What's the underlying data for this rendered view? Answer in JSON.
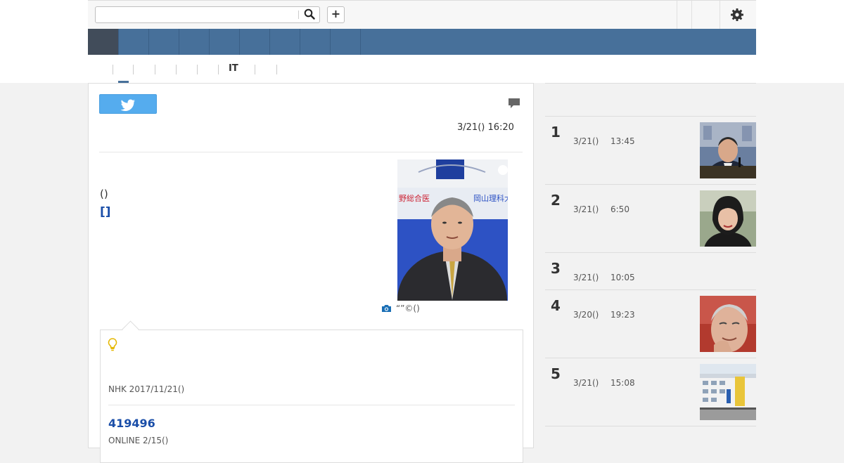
{
  "toolbar": {
    "search_placeholder": "",
    "search_icon": "search-icon",
    "add_label": "+",
    "settings_icon": "gear-icon"
  },
  "categories": {
    "it_label": "IT"
  },
  "article": {
    "date": "3/21() 16:20",
    "paren_text": "()",
    "link_text": "[]",
    "photo_caption": "“”©()",
    "related": {
      "source1": "NHK 2017/11/21()",
      "link_number": "419496",
      "source2": "ONLINE 2/15()"
    }
  },
  "ranking": [
    {
      "num": "1",
      "date": "3/21()",
      "time": "13:45",
      "has_thumb": true
    },
    {
      "num": "2",
      "date": "3/21()",
      "time": "6:50",
      "has_thumb": true
    },
    {
      "num": "3",
      "date": "3/21()",
      "time": "10:05",
      "has_thumb": false
    },
    {
      "num": "4",
      "date": "3/20()",
      "time": "19:23",
      "has_thumb": true
    },
    {
      "num": "5",
      "date": "3/21()",
      "time": "15:08",
      "has_thumb": true
    }
  ],
  "colors": {
    "nav_blue": "#47709a",
    "nav_active": "#414c5a",
    "link_blue": "#1a4ea8",
    "twitter_blue": "#55acee"
  }
}
